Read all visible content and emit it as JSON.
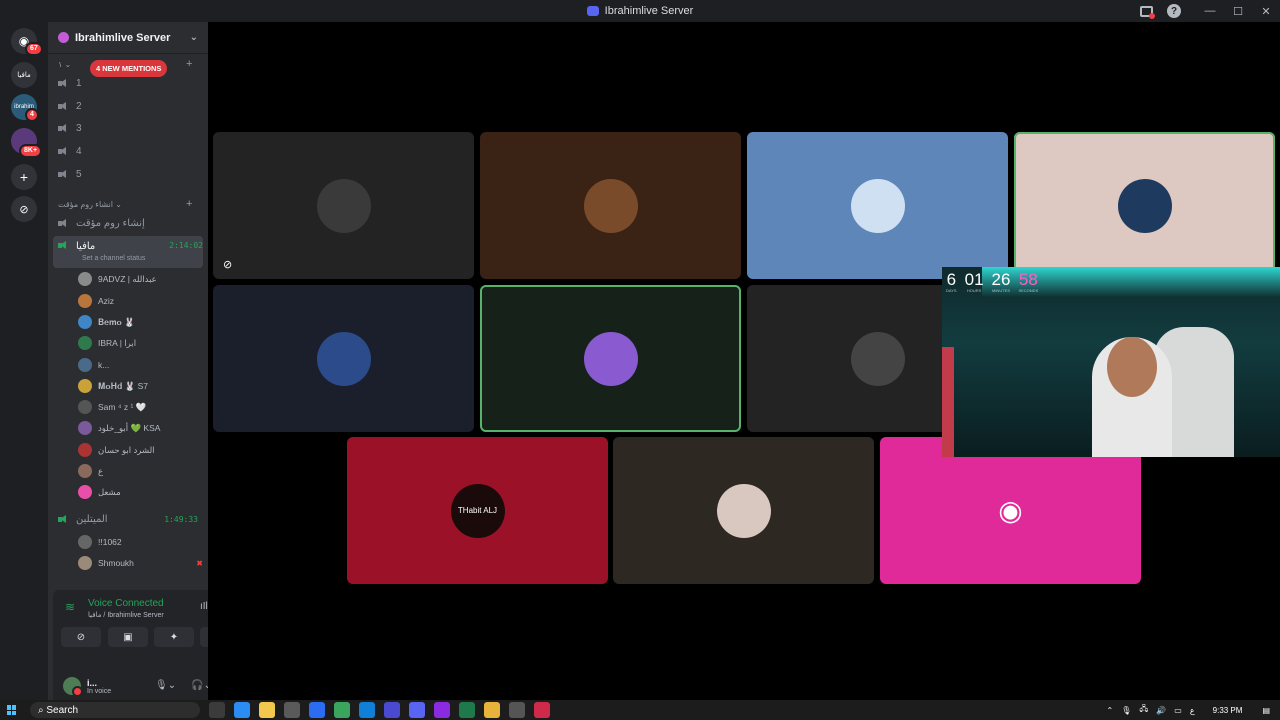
{
  "window": {
    "title": "Ibrahimlive Server"
  },
  "guilds": {
    "home_badge": "67",
    "server_badge": "4",
    "server2_badge": "8K+"
  },
  "server": {
    "name": "Ibrahimlive Server"
  },
  "categories": [
    {
      "label": "١"
    },
    {
      "label": "انشاء روم مؤقت"
    }
  ],
  "mentions_pill": "4 NEW MENTIONS",
  "voice_channels": [
    {
      "name": "1"
    },
    {
      "name": "2"
    },
    {
      "name": "3"
    },
    {
      "name": "4"
    },
    {
      "name": "5"
    }
  ],
  "temp_channel": {
    "name": "إنشاء روم مؤقت"
  },
  "active_channel": {
    "name": "مافيا",
    "time": "2:14:02",
    "status": "Set a channel status"
  },
  "members": [
    {
      "name": "9ADVZ | عبدالله",
      "color": "#8a8a8a"
    },
    {
      "name": "Aziz",
      "color": "#b7773c"
    },
    {
      "name": "𝐁𝐞𝐦𝐨 🐰",
      "color": "#3e86c5"
    },
    {
      "name": "IBRA | ابرا",
      "color": "#2f7a4d"
    },
    {
      "name": "k...",
      "color": "#4a6a8a"
    },
    {
      "name": "𝐌𝐨𝐇𝐝 🐰 S7",
      "color": "#c9a23a"
    },
    {
      "name": "Sam ⁴ z ¹ 🤍",
      "color": "#555"
    },
    {
      "name": "أبو_خلود 💚 KSA",
      "color": "#7a5a9a"
    },
    {
      "name": "الشرد ابو حسان",
      "color": "#a33"
    },
    {
      "name": "ع",
      "color": "#8a6a5a"
    },
    {
      "name": "مشعل",
      "color": "#e94fa8"
    }
  ],
  "second_channel": {
    "name": "الميتلين",
    "time": "1:49:33"
  },
  "second_members": [
    {
      "name": "!!1062",
      "color": "#666"
    },
    {
      "name": "Shmoukh",
      "color": "#9a8a7a"
    }
  ],
  "voice_panel": {
    "title": "Voice Connected",
    "subtitle": "مافيا / Ibrahimlive Server"
  },
  "user": {
    "name": "i...",
    "status": "In voice"
  },
  "tiles": [
    {
      "bg": "#232323",
      "pic": "#3a3a3a"
    },
    {
      "bg": "#3a2314",
      "pic": "#7a4b2b"
    },
    {
      "bg": "#5e86b8",
      "pic": "#cfe0f2"
    },
    {
      "bg": "#ddc9c2",
      "pic": "#1f3a5f"
    },
    {
      "bg": "#1a1f2b",
      "pic": "#2b4b8a"
    },
    {
      "bg": "#16211a",
      "pic": "#8a5ad0"
    },
    {
      "bg": "#232323",
      "pic": "#444"
    },
    {
      "bg": "#9b1127",
      "pic": "#1a0a0a",
      "label": "THabit ALJ"
    },
    {
      "bg": "#2d2822",
      "pic": "#d8c8c0"
    },
    {
      "bg": "#e02a9a",
      "pic": "#e02a9a"
    }
  ],
  "countdown": [
    {
      "n": "6",
      "l": "DAYS"
    },
    {
      "n": "01",
      "l": "HOURS"
    },
    {
      "n": "26",
      "l": "MINUTES"
    },
    {
      "n": "58",
      "l": "SECONDS"
    }
  ],
  "taskbar": {
    "search": "Search",
    "lang": "ع",
    "time": "9:33 PM"
  }
}
